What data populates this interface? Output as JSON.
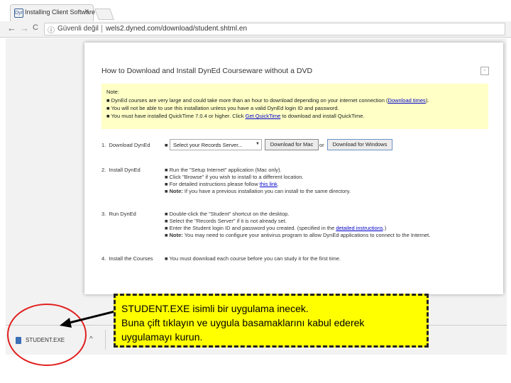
{
  "browser": {
    "tab_icon": "Dyn",
    "tab_title": "Installing Client Software",
    "tab_close": "×",
    "back": "←",
    "forward": "→",
    "reload": "C",
    "secure_label": "Güvenli değil",
    "url": "wels2.dyned.com/download/student.shtml.en"
  },
  "page": {
    "title": "How to Download and Install DynEd Courseware without a DVD",
    "note": {
      "label": "Note:",
      "line1_pre": "DynEd courses are very large and could take more than an hour to download depending on your internet connection (",
      "line1_link": "Download times",
      "line1_post": ").",
      "line2": "You will not be able to use this installation unless you have a valid DynEd login ID and password.",
      "line3_pre": "You must have installed QuickTime 7.0.4 or higher. Click ",
      "line3_link": "Get QuickTime",
      "line3_post": " to download and install QuickTime."
    },
    "steps": [
      {
        "num": "1.",
        "label": "Download DynEd"
      },
      {
        "num": "2.",
        "label": "Install DynEd"
      },
      {
        "num": "3.",
        "label": "Run DynEd"
      },
      {
        "num": "4.",
        "label": "Install the Courses"
      }
    ],
    "download": {
      "server_placeholder": "Select your Records Server...",
      "mac_button": "Download for Mac",
      "or": "or",
      "win_button": "Download for Windows"
    },
    "install": {
      "b1": "Run the \"Setup Internet\" application (Mac only).",
      "b2": "Click \"Browse\" if you wish to install to a different location.",
      "b3_pre": "For detailed instructions please follow ",
      "b3_link": "this link",
      "b3_post": ".",
      "b4_bold": "Note:",
      "b4_rest": " If you have a previous installation you can install to the same directory."
    },
    "run": {
      "b1": "Double-click the \"Student\" shortcut on the desktop.",
      "b2": "Select the \"Records Server\" if it is not already set.",
      "b3_pre": "Enter the Student login ID and password you created. (specified in the ",
      "b3_link": "detailed instructions",
      "b3_post": ".)",
      "b4_bold": "Note:",
      "b4_rest": " You may need to configure your antivirus program to allow DynEd applications to connect to the Internet."
    },
    "courses": {
      "b1": "You must download each course before you can study it for the first time."
    }
  },
  "download_bar": {
    "filename": "STUDENT.EXE",
    "chevron": "^"
  },
  "annotation": {
    "line1": "STUDENT.EXE  isimli bir uygulama inecek.",
    "line2": "Buna çift tıklayın ve uygula basamaklarını kabul ederek",
    "line3": "uygulamayı kurun."
  },
  "colors": {
    "callout_fill": "#ffff00",
    "circle_stroke": "#e21f1f",
    "note_fill": "#ffffc6",
    "link": "#0000cc"
  }
}
